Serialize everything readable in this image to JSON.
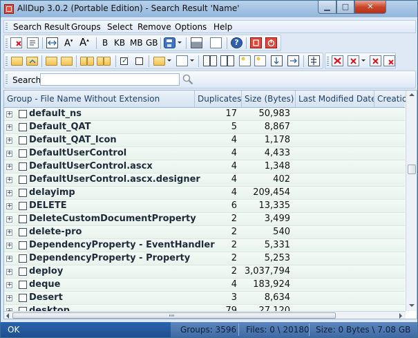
{
  "window": {
    "title": "AllDup 3.0.2 (Portable Edition) - Search Result 'Name'",
    "controls": {
      "minimize": "▁",
      "maximize": "□",
      "close": "✕"
    }
  },
  "menu": [
    "Search Result",
    "Groups",
    "Select",
    "Remove",
    "Options",
    "Help"
  ],
  "toolbar1": {
    "size_labels": [
      "B",
      "KB",
      "MB",
      "GB"
    ],
    "icons": [
      "remove-icon",
      "properties-icon",
      "compare-icon",
      "font-size-decrease-icon",
      "font-size-increase-icon",
      "save-icon",
      "print-icon",
      "page-setup-icon",
      "help-icon",
      "stop-icon",
      "exit-icon"
    ]
  },
  "toolbar2": {
    "icons": [
      "open-folder-icon",
      "open-parent-icon",
      "open-group-icon",
      "open-all-icon",
      "folder-pair-icon",
      "folder-pair-2-icon",
      "check-all-icon",
      "uncheck-icon",
      "add-to-list-icon",
      "list-view-icon",
      "tree-view-icon",
      "mark-icon",
      "mark-2-icon",
      "move-icon",
      "copy-icon",
      "sort-icon",
      "delete-icon",
      "delete-options-icon",
      "delete-file-icon",
      "delete-recycle-icon"
    ]
  },
  "search": {
    "label": "Search:",
    "value": "",
    "placeholder": ""
  },
  "columns": [
    "Group - File Name Without Extension",
    "Duplicates",
    "Size (Bytes)",
    "Last Modified Date",
    "Creation"
  ],
  "rows": [
    {
      "name": "default_ns",
      "duplicates": "17",
      "size": "50,983"
    },
    {
      "name": "Default_QAT",
      "duplicates": "5",
      "size": "8,867"
    },
    {
      "name": "Default_QAT_Icon",
      "duplicates": "4",
      "size": "1,178"
    },
    {
      "name": "DefaultUserControl",
      "duplicates": "4",
      "size": "4,433"
    },
    {
      "name": "DefaultUserControl.ascx",
      "duplicates": "4",
      "size": "1,348"
    },
    {
      "name": "DefaultUserControl.ascx.designer",
      "duplicates": "4",
      "size": "402"
    },
    {
      "name": "delayimp",
      "duplicates": "4",
      "size": "209,454"
    },
    {
      "name": "DELETE",
      "duplicates": "6",
      "size": "13,335"
    },
    {
      "name": "DeleteCustomDocumentProperty",
      "duplicates": "2",
      "size": "3,499"
    },
    {
      "name": "delete-pro",
      "duplicates": "2",
      "size": "540"
    },
    {
      "name": "DependencyProperty - EventHandler",
      "duplicates": "2",
      "size": "5,331"
    },
    {
      "name": "DependencyProperty - Property",
      "duplicates": "2",
      "size": "5,253"
    },
    {
      "name": "deploy",
      "duplicates": "2",
      "size": "3,037,794"
    },
    {
      "name": "deque",
      "duplicates": "4",
      "size": "183,924"
    },
    {
      "name": "Desert",
      "duplicates": "3",
      "size": "8,634"
    },
    {
      "name": "desktop",
      "duplicates": "79",
      "size": "27,120"
    }
  ],
  "status": {
    "state": "OK",
    "groups": "Groups: 3596",
    "files": "Files: 0 \\ 20180",
    "size": "Size: 0 Bytes \\ 7.08 GB"
  },
  "colors": {
    "accent": "#2a64ad",
    "row_bg": "#eef6f2",
    "header_text": "#1e3f66"
  }
}
